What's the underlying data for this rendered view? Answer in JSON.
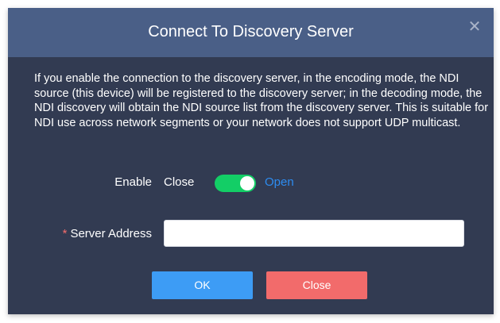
{
  "dialog": {
    "title": "Connect To Discovery Server",
    "close_icon": "close-icon",
    "description": "If you enable the connection to the discovery server, in the encoding mode, the NDI source (this device) will be registered to the discovery server; in the decoding mode, the NDI discovery will obtain the NDI source list from the discovery server. This is suitable for NDI use across network segments or your network does not support UDP multicast."
  },
  "enable": {
    "label": "Enable",
    "off_text": "Close",
    "on_text": "Open",
    "state": "on",
    "on_color": "#13ce66",
    "active_text_color": "#2d8cf0"
  },
  "server_address": {
    "required_mark": "*",
    "label": "Server Address",
    "value": "",
    "placeholder": ""
  },
  "buttons": {
    "ok_label": "OK",
    "close_label": "Close",
    "ok_color": "#3d9cf5",
    "close_color": "#f26b6b"
  },
  "colors": {
    "header_bg": "#4a5f87",
    "body_bg": "#323b52"
  }
}
